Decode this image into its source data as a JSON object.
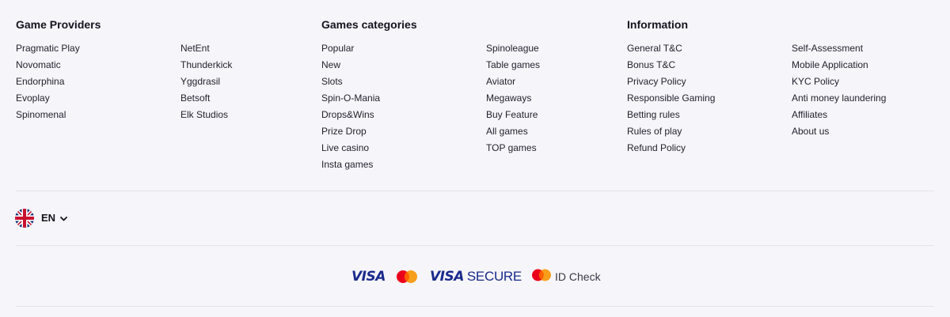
{
  "footer": {
    "providers": {
      "title": "Game Providers",
      "col1": [
        "Pragmatic Play",
        "Novomatic",
        "Endorphina",
        "Evoplay",
        "Spinomenal"
      ],
      "col2": [
        "NetEnt",
        "Thunderkick",
        "Yggdrasil",
        "Betsoft",
        "Elk Studios"
      ]
    },
    "categories": {
      "title": "Games categories",
      "col1": [
        "Popular",
        "New",
        "Slots",
        "Spin-O-Mania",
        "Drops&Wins",
        "Prize Drop",
        "Live casino",
        "Insta games"
      ],
      "col2": [
        "Spinoleague",
        "Table games",
        "Aviator",
        "Megaways",
        "Buy Feature",
        "All games",
        "TOP games"
      ]
    },
    "information": {
      "title": "Information",
      "col1": [
        "General T&C",
        "Bonus T&C",
        "Privacy Policy",
        "Responsible Gaming",
        "Betting rules",
        "Rules of play",
        "Refund Policy"
      ],
      "col2": [
        "Self-Assessment",
        "Mobile Application",
        "KYC Policy",
        "Anti money laundering",
        "Affiliates",
        "About us"
      ]
    },
    "language": {
      "code": "EN",
      "flag_icon": "uk-flag-icon",
      "chevron_icon": "chevron-down-icon"
    },
    "payments": {
      "visa": "VISA",
      "visa_secure_brand": "VISA",
      "visa_secure_text": "SECURE",
      "id_check": "ID Check",
      "mastercard_colors": [
        "#eb001b",
        "#f79e1b",
        "#ff5f00"
      ]
    }
  }
}
